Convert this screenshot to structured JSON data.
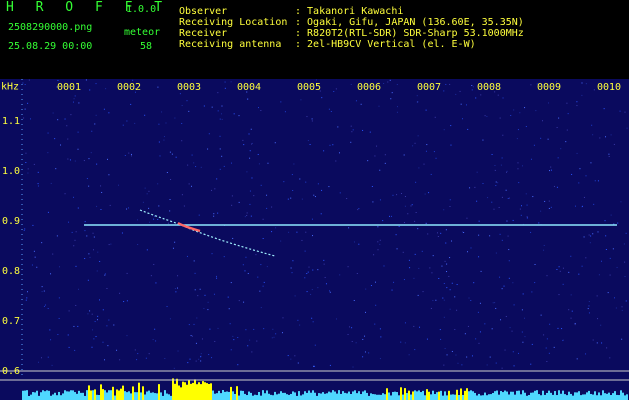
{
  "header": {
    "app_name": "H R O F F T",
    "version": "1.0.0",
    "filename": "2508290000.png",
    "datetime": "25.08.29 00:00",
    "count_label": "meteor",
    "count_value": "58",
    "info_labels": [
      "Observer",
      "Receiving Location",
      "Receiver",
      "Receiving antenna"
    ],
    "info_values": [
      ": Takanori Kawachi",
      ": Ogaki, Gifu, JAPAN (136.60E, 35.35N)",
      ": R820T2(RTL-SDR) SDR-Sharp 53.1000MHz",
      ": 2el-HB9CV Vertical (el. E-W)"
    ]
  },
  "spectrogram": {
    "y_unit": "kHz",
    "y_ticks": [
      "1.1",
      "1.0",
      "0.9",
      "0.8",
      "0.7",
      "0.6"
    ],
    "x_ticks": [
      "0001",
      "0002",
      "0003",
      "0004",
      "0005",
      "0006",
      "0007",
      "0008",
      "0009",
      "0010"
    ],
    "colors": {
      "background": "#0a0a5e",
      "text": "#ffff3c",
      "green": "#34ff34",
      "trace": "#7fffd0",
      "histogram": "#4fd8ff",
      "peak": "#ffff00"
    }
  }
}
